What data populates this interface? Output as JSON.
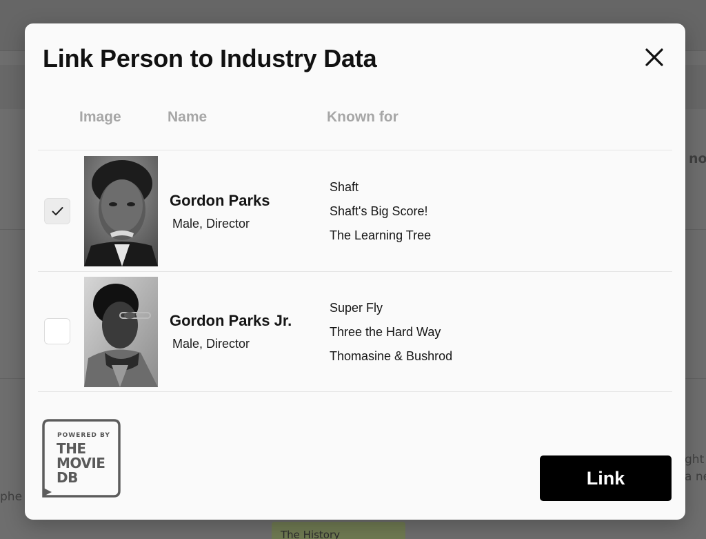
{
  "background": {
    "fragments": {
      "right_top": "no",
      "right_mid_1": "ght",
      "right_mid_2": "a ne",
      "left_bottom": "phe",
      "bottom_tag": "The History"
    }
  },
  "modal": {
    "title": "Link Person to Industry Data",
    "close_icon": "close-icon",
    "columns": {
      "image": "Image",
      "name": "Name",
      "known_for": "Known for"
    },
    "rows": [
      {
        "checked": true,
        "name": "Gordon Parks",
        "meta": "Male, Director",
        "known_for": [
          "Shaft",
          "Shaft's Big Score!",
          "The Learning Tree"
        ],
        "photo_icon": "person-photo"
      },
      {
        "checked": false,
        "name": "Gordon Parks Jr.",
        "meta": "Male, Director",
        "known_for": [
          "Super Fly",
          "Three the Hard Way",
          "Thomasine & Bushrod"
        ],
        "photo_icon": "person-photo"
      }
    ],
    "tmdb_badge": {
      "powered_by": "POWERED BY",
      "line1": "THE",
      "line2": "MOVIE",
      "line3": "DB"
    },
    "link_button": "Link"
  },
  "colors": {
    "overlay": "#6b6b6b",
    "modal_bg": "#fafafa",
    "primary_button": "#000000",
    "header_text": "#a6a6a6"
  }
}
